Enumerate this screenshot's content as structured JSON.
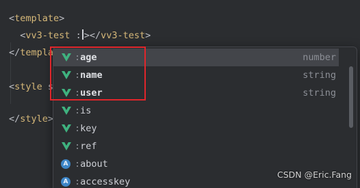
{
  "editor": {
    "lines": [
      {
        "open": "<",
        "tag": "template",
        "close": ">"
      },
      {
        "indent": "  ",
        "open": "<",
        "tag": "vv3-test",
        "attr_text": ":",
        "after_caret": ">",
        "close_open": "</",
        "close_tag": "vv3-test",
        "close_close": ">"
      },
      {
        "open": "</",
        "tag": "template",
        "close": ">"
      },
      {
        "open": "<",
        "tag": "style",
        "rest": "s"
      },
      {
        "open": "</",
        "tag": "style",
        "close": ">"
      }
    ]
  },
  "completion_popup": {
    "items": [
      {
        "icon": "vue-icon",
        "colon": ":",
        "name": "age",
        "type": "number",
        "selected": true
      },
      {
        "icon": "vue-icon",
        "colon": ":",
        "name": "name",
        "type": "string",
        "selected": false
      },
      {
        "icon": "vue-icon",
        "colon": ":",
        "name": "user",
        "type": "string",
        "selected": false
      },
      {
        "icon": "vue-icon",
        "colon": ":",
        "name": "is",
        "type": "",
        "selected": false
      },
      {
        "icon": "vue-icon",
        "colon": ":",
        "name": "key",
        "type": "",
        "selected": false
      },
      {
        "icon": "vue-icon",
        "colon": ":",
        "name": "ref",
        "type": "",
        "selected": false
      },
      {
        "icon": "attribute-icon",
        "icon_text": "A",
        "colon": ":",
        "name": "about",
        "type": "",
        "selected": false
      },
      {
        "icon": "attribute-icon",
        "icon_text": "A",
        "colon": ":",
        "name": "accesskey",
        "type": "",
        "selected": false
      }
    ]
  },
  "colors": {
    "background": "#2b2d30",
    "tag": "#d5b778",
    "vue_green": "#3fb27f",
    "highlight": "#e0262b",
    "selected_row": "#43454a"
  },
  "watermark": "CSDN @Eric.Fang"
}
